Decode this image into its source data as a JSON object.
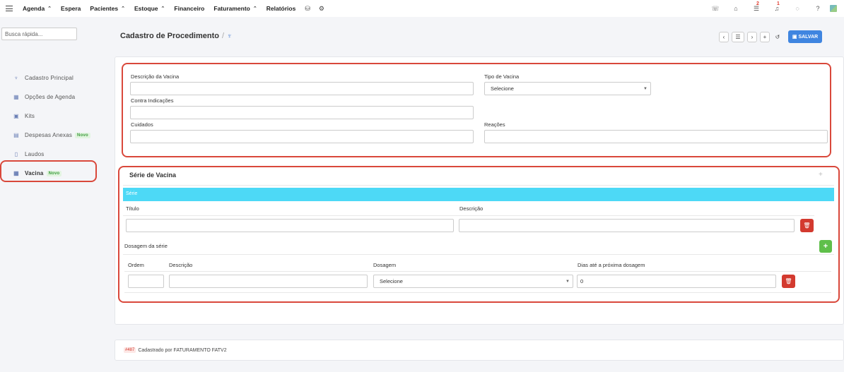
{
  "topbar": {
    "menu": [
      {
        "label": "Agenda",
        "caret": true
      },
      {
        "label": "Espera",
        "caret": false
      },
      {
        "label": "Pacientes",
        "caret": true
      },
      {
        "label": "Estoque",
        "caret": true
      },
      {
        "label": "Financeiro",
        "caret": false
      },
      {
        "label": "Faturamento",
        "caret": true
      },
      {
        "label": "Relatórios",
        "caret": false
      }
    ],
    "caret_glyph": "⌃",
    "extra_icons": [
      "database-icon",
      "gear-icon"
    ],
    "right_icons": [
      {
        "name": "phone-icon",
        "badge": ""
      },
      {
        "name": "inbox-icon",
        "badge": ""
      },
      {
        "name": "tasks-icon",
        "badge": "2"
      },
      {
        "name": "bell-icon",
        "badge": "1"
      },
      {
        "name": "chat-icon",
        "badge": ""
      },
      {
        "name": "help-icon",
        "badge": ""
      }
    ]
  },
  "sidebar": {
    "search_placeholder": "Busca rápida...",
    "items": [
      {
        "label": "Cadastro Principal",
        "icon": "stethoscope-icon",
        "badge": ""
      },
      {
        "label": "Opções de Agenda",
        "icon": "calendar-icon",
        "badge": ""
      },
      {
        "label": "Kits",
        "icon": "box-icon",
        "badge": ""
      },
      {
        "label": "Despesas Anexas",
        "icon": "card-icon",
        "badge": "Novo"
      },
      {
        "label": "Laudos",
        "icon": "file-icon",
        "badge": ""
      },
      {
        "label": "Vacina",
        "icon": "calendar-icon",
        "badge": "Novo",
        "active": true
      }
    ]
  },
  "header": {
    "title": "Cadastro de Procedimento",
    "separator": "/",
    "save_label": "SALVAR"
  },
  "form": {
    "descricao_label": "Descrição da Vacina",
    "descricao_value": "",
    "tipo_label": "Tipo de Vacina",
    "tipo_value": "Selecione",
    "contra_label": "Contra Indicações",
    "contra_value": "",
    "cuidados_label": "Cuidados",
    "cuidados_value": "",
    "reacoes_label": "Reações",
    "reacoes_value": ""
  },
  "serie": {
    "card_title": "Série de Vacina",
    "bar_label": "Série",
    "titulo_label": "Título",
    "titulo_value": "",
    "descricao_label": "Descrição",
    "descricao_value": "",
    "dosagem_section": "Dosagem da série",
    "columns": {
      "ordem": "Ordem",
      "descricao": "Descrição",
      "dosagem": "Dosagem",
      "dias": "Dias até a próxima dosagem"
    },
    "row": {
      "ordem": "",
      "descricao": "",
      "dosagem": "Selecione",
      "dias": "0"
    }
  },
  "footer": {
    "id": "#487",
    "text": "Cadastrado por FATURAMENTO FATV2"
  },
  "colors": {
    "accent": "#3f85e0",
    "highlight_outline": "#d9483b",
    "serie_bar": "#4dd9f6",
    "delete": "#d33a2f",
    "add": "#5fbf4a"
  }
}
